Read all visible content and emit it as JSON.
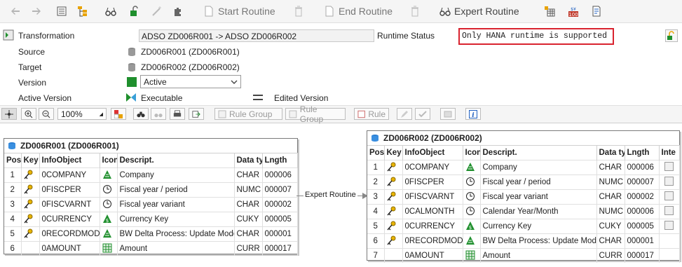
{
  "toolbar": {
    "start_routine": "Start Routine",
    "end_routine": "End Routine",
    "expert_routine": "Expert Routine"
  },
  "header": {
    "transformation_label": "Transformation",
    "transformation_value": "ADSO ZD006R001 -> ADSO ZD006R002",
    "runtime_status_label": "Runtime Status",
    "runtime_status_value": "Only HANA runtime is supported",
    "source_label": "Source",
    "source_value": "ZD006R001 (ZD006R001)",
    "target_label": "Target",
    "target_value": "ZD006R002 (ZD006R002)",
    "version_label": "Version",
    "version_value": "Active",
    "active_version_label": "Active Version",
    "active_version_value": "Executable",
    "edited_version_label": "Edited Version"
  },
  "toolbar2": {
    "zoom": "100%",
    "rule_group_1": "Rule Group",
    "rule_group_2": "Rule Group",
    "rule": "Rule"
  },
  "source_table": {
    "title": "ZD006R001 (ZD006R001)",
    "columns": [
      "Pos",
      "Key",
      "InfoObject",
      "Icon",
      "Descript.",
      "Data type",
      "Lngth"
    ],
    "rows": [
      {
        "pos": "1",
        "key": "key",
        "infoobject": "0COMPANY",
        "icon": "characteristic-icon",
        "desc": "Company",
        "type": "CHAR",
        "len": "000006"
      },
      {
        "pos": "2",
        "key": "key",
        "infoobject": "0FISCPER",
        "icon": "time-icon",
        "desc": "Fiscal year / period",
        "type": "NUMC",
        "len": "000007"
      },
      {
        "pos": "3",
        "key": "key",
        "infoobject": "0FISCVARNT",
        "icon": "time-icon",
        "desc": "Fiscal year variant",
        "type": "CHAR",
        "len": "000002"
      },
      {
        "pos": "4",
        "key": "key",
        "infoobject": "0CURRENCY",
        "icon": "unit-icon",
        "desc": "Currency Key",
        "type": "CUKY",
        "len": "000005"
      },
      {
        "pos": "5",
        "key": "key",
        "infoobject": "0RECORDMODE",
        "icon": "characteristic-icon",
        "desc": "BW Delta Process: Update Mode",
        "type": "CHAR",
        "len": "000001"
      },
      {
        "pos": "6",
        "key": "",
        "infoobject": "0AMOUNT",
        "icon": "keyfigure-icon",
        "desc": "Amount",
        "type": "CURR",
        "len": "000017"
      }
    ]
  },
  "connector_label": "Expert Routine",
  "target_table": {
    "title": "ZD006R002 (ZD006R002)",
    "columns": [
      "Pos",
      "Key",
      "InfoObject",
      "Icon",
      "Descript.",
      "Data type",
      "Lngth",
      "Inte"
    ],
    "rows": [
      {
        "pos": "1",
        "key": "key",
        "infoobject": "0COMPANY",
        "icon": "characteristic-icon",
        "desc": "Company",
        "type": "CHAR",
        "len": "000006",
        "cb": true
      },
      {
        "pos": "2",
        "key": "key",
        "infoobject": "0FISCPER",
        "icon": "time-icon",
        "desc": "Fiscal year / period",
        "type": "NUMC",
        "len": "000007",
        "cb": true
      },
      {
        "pos": "3",
        "key": "key",
        "infoobject": "0FISCVARNT",
        "icon": "time-icon",
        "desc": "Fiscal year variant",
        "type": "CHAR",
        "len": "000002",
        "cb": true
      },
      {
        "pos": "4",
        "key": "key",
        "infoobject": "0CALMONTH",
        "icon": "time-icon",
        "desc": "Calendar Year/Month",
        "type": "NUMC",
        "len": "000006",
        "cb": true
      },
      {
        "pos": "5",
        "key": "key",
        "infoobject": "0CURRENCY",
        "icon": "unit-icon",
        "desc": "Currency Key",
        "type": "CUKY",
        "len": "000005",
        "cb": true
      },
      {
        "pos": "6",
        "key": "key",
        "infoobject": "0RECORDMODE",
        "icon": "characteristic-icon",
        "desc": "BW Delta Process: Update Mode",
        "type": "CHAR",
        "len": "000001",
        "cb": false
      },
      {
        "pos": "7",
        "key": "",
        "infoobject": "0AMOUNT",
        "icon": "keyfigure-icon",
        "desc": "Amount",
        "type": "CURR",
        "len": "000017",
        "cb": false
      }
    ]
  }
}
